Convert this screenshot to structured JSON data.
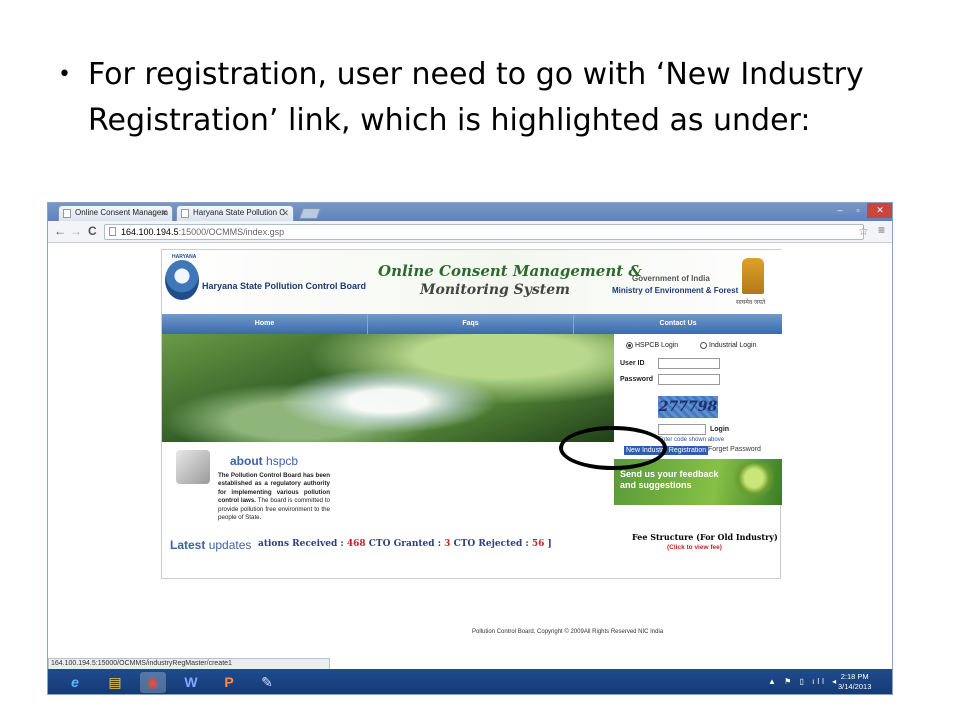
{
  "slide": {
    "bullet": "•",
    "text": "For registration, user need to go with ‘New Industry Registration’ link, which is highlighted as under:"
  },
  "browser": {
    "tabs": [
      {
        "label": "Online Consent Managem",
        "close": "✕"
      },
      {
        "label": "Haryana State Pollution C",
        "close": "✕"
      }
    ],
    "window_controls": {
      "minimize": "–",
      "restore": "▫",
      "close": "✕"
    },
    "nav": {
      "back": "←",
      "forward": "→",
      "reload": "C"
    },
    "url": {
      "host": "164.100.194.5",
      "path": ":15000/OCMMS/index.gsp"
    },
    "star": "☆",
    "menu": "≡",
    "status_url": "164.100.194.5:15000/OCMMS/industryRegMaster/create1"
  },
  "site": {
    "logo_top": "HARYANA",
    "org_name": "Haryana State Pollution Control Board",
    "system_title_1": "Online Consent Management &",
    "system_title_2": "Monitoring System",
    "gov": "Government of India",
    "ministry": "Ministry of Environment & Forest",
    "motto": "सत्यमेव जयते",
    "nav": [
      "Home",
      "Faqs",
      "Contact Us"
    ],
    "login": {
      "option_hspcb": "HSPCB Login",
      "option_industrial": "Industrial Login",
      "user_id_label": "User ID",
      "password_label": "Password",
      "captcha_text": "277798",
      "login_label": "Login",
      "enter_code_hint": "Enter code shown above",
      "new_registration": "New Industry Registration",
      "forgot_password": "Forget Password"
    },
    "about": {
      "heading_about": "about",
      "heading_hspcb": "hspcb",
      "text_bold": "The Pollution Control Board has been established as a regulatory authority for implementing various pollution control laws.",
      "text_normal": " The board is committed to provide pollution free environment to the people of State."
    },
    "feedback": {
      "line1": "Send us your feedback",
      "line2": "and suggestions"
    },
    "latest": {
      "word1": "Latest",
      "word2": "updates"
    },
    "ticker": {
      "part1": "ations Received : ",
      "received": "468",
      "part2": "   CTO Granted : ",
      "granted": "3",
      "part3": "   CTO Rejected : ",
      "rejected": "56",
      "end": " ]"
    },
    "fee_title": "Fee Structure (For Old Industry)",
    "fee_link": "(Click to view fee)",
    "footer": "Pollution Control Board, Copyright © 2009All Rights Reserved NIC India"
  },
  "taskbar": {
    "icons": [
      "e",
      "▤",
      "◉",
      "W",
      "P",
      "✎"
    ],
    "tray": "▲ ⚑ ▯ ıll ◂",
    "time": "2:18 PM",
    "date": "3/14/2013"
  },
  "colors": {
    "nav_blue": "#3c6aa9",
    "link_blue": "#3e62a8",
    "accent_red": "#c0252c"
  }
}
